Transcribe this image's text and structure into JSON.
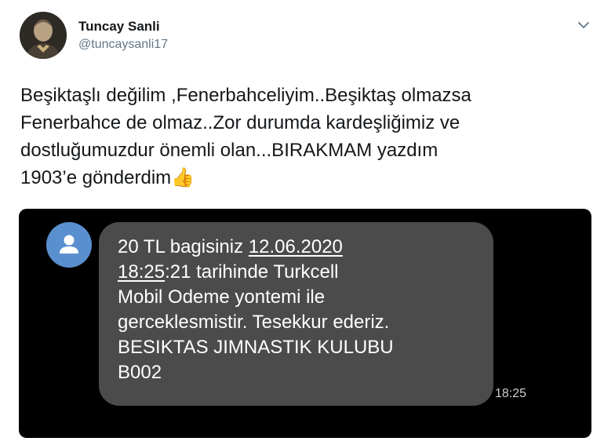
{
  "user": {
    "name": "Tuncay Sanli",
    "handle": "@tuncaysanli17"
  },
  "tweet": {
    "lines": [
      "Beşiktaşlı değilim ,Fenerbahceliyim..Beşiktaş olmazsa",
      "Fenerbahce de olmaz..Zor durumda kardeşliğimiz ve",
      "dostluğumuzdur önemli olan...BIRAKMAM yazdım",
      "1903’e gönderdim"
    ],
    "emoji": "👍"
  },
  "sms": {
    "line1_prefix": "20 TL bagisiniz ",
    "date": "12.06.2020",
    "time_link": "18:25",
    "line2_rest": ":21 tarihinde Turkcell",
    "line3": "Mobil Odeme yontemi ile",
    "line4": "gerceklesmistir. Tesekkur ederiz.",
    "line5": "BESIKTAS JIMNASTIK KULUBU",
    "line6": "B002",
    "timestamp": "18:25"
  },
  "colors": {
    "text": "#14171a",
    "secondary": "#657786",
    "bubble": "#4b4b4b",
    "sms_avatar": "#5a8fcf"
  },
  "icons": {
    "menu": "chevron-down-icon",
    "contact": "person-icon",
    "thumbs": "thumbs-up-icon"
  }
}
